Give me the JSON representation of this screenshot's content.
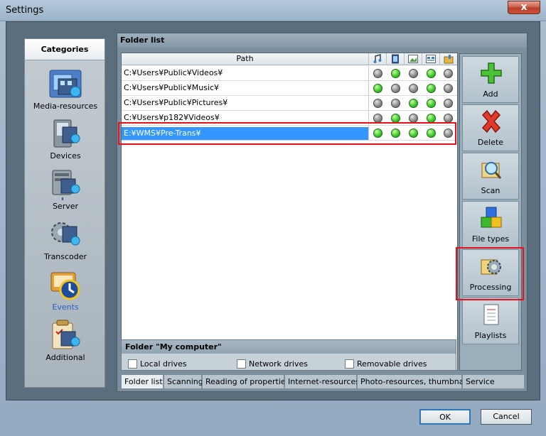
{
  "window": {
    "title": "Settings",
    "close_glyph": "x"
  },
  "categories": {
    "header": "Categories",
    "items": [
      {
        "label": "Media-resources",
        "icon": "media-resources-icon"
      },
      {
        "label": "Devices",
        "icon": "devices-icon"
      },
      {
        "label": "Server",
        "icon": "server-icon"
      },
      {
        "label": "Transcoder",
        "icon": "transcoder-icon"
      },
      {
        "label": "Events",
        "icon": "events-icon",
        "active": true
      },
      {
        "label": "Additional",
        "icon": "additional-icon"
      }
    ]
  },
  "folder_list": {
    "title": "Folder list",
    "columns": {
      "path": "Path",
      "icons": [
        "music-icon",
        "video-icon",
        "picture-icon",
        "web-icon",
        "folder-icon"
      ]
    },
    "rows": [
      {
        "path": "C:¥Users¥Public¥Videos¥",
        "flags": [
          false,
          true,
          false,
          true,
          false
        ]
      },
      {
        "path": "C:¥Users¥Public¥Music¥",
        "flags": [
          true,
          false,
          false,
          true,
          false
        ]
      },
      {
        "path": "C:¥Users¥Public¥Pictures¥",
        "flags": [
          false,
          false,
          true,
          true,
          false
        ]
      },
      {
        "path": "C:¥Users¥p182¥Videos¥",
        "flags": [
          false,
          true,
          false,
          true,
          false
        ]
      },
      {
        "path": "E:¥WMS¥Pre-Trans¥",
        "flags": [
          true,
          true,
          true,
          true,
          false
        ],
        "selected": true
      }
    ]
  },
  "actions": [
    {
      "label": "Add",
      "icon": "add-icon"
    },
    {
      "label": "Delete",
      "icon": "delete-icon"
    },
    {
      "label": "Scan",
      "icon": "scan-icon"
    },
    {
      "label": "File types",
      "icon": "file-types-icon"
    },
    {
      "label": "Processing",
      "icon": "processing-icon"
    },
    {
      "label": "Playlists",
      "icon": "playlists-icon"
    }
  ],
  "my_computer": {
    "title": "Folder \"My computer\"",
    "options": [
      {
        "label": "Local drives",
        "checked": false
      },
      {
        "label": "Network drives",
        "checked": false
      },
      {
        "label": "Removable drives",
        "checked": false
      }
    ]
  },
  "tabs": [
    {
      "label": "Folder list",
      "active": true
    },
    {
      "label": "Scanning"
    },
    {
      "label": "Reading of properties"
    },
    {
      "label": "Internet-resources"
    },
    {
      "label": "Photo-resources, thumbnails"
    },
    {
      "label": "Service"
    }
  ],
  "buttons": {
    "ok": "OK",
    "cancel": "Cancel"
  },
  "colors": {
    "selection": "#3397ff",
    "highlight": "#e8101d",
    "status_on": "#3fcb2f",
    "status_off": "#8d8d8d"
  }
}
